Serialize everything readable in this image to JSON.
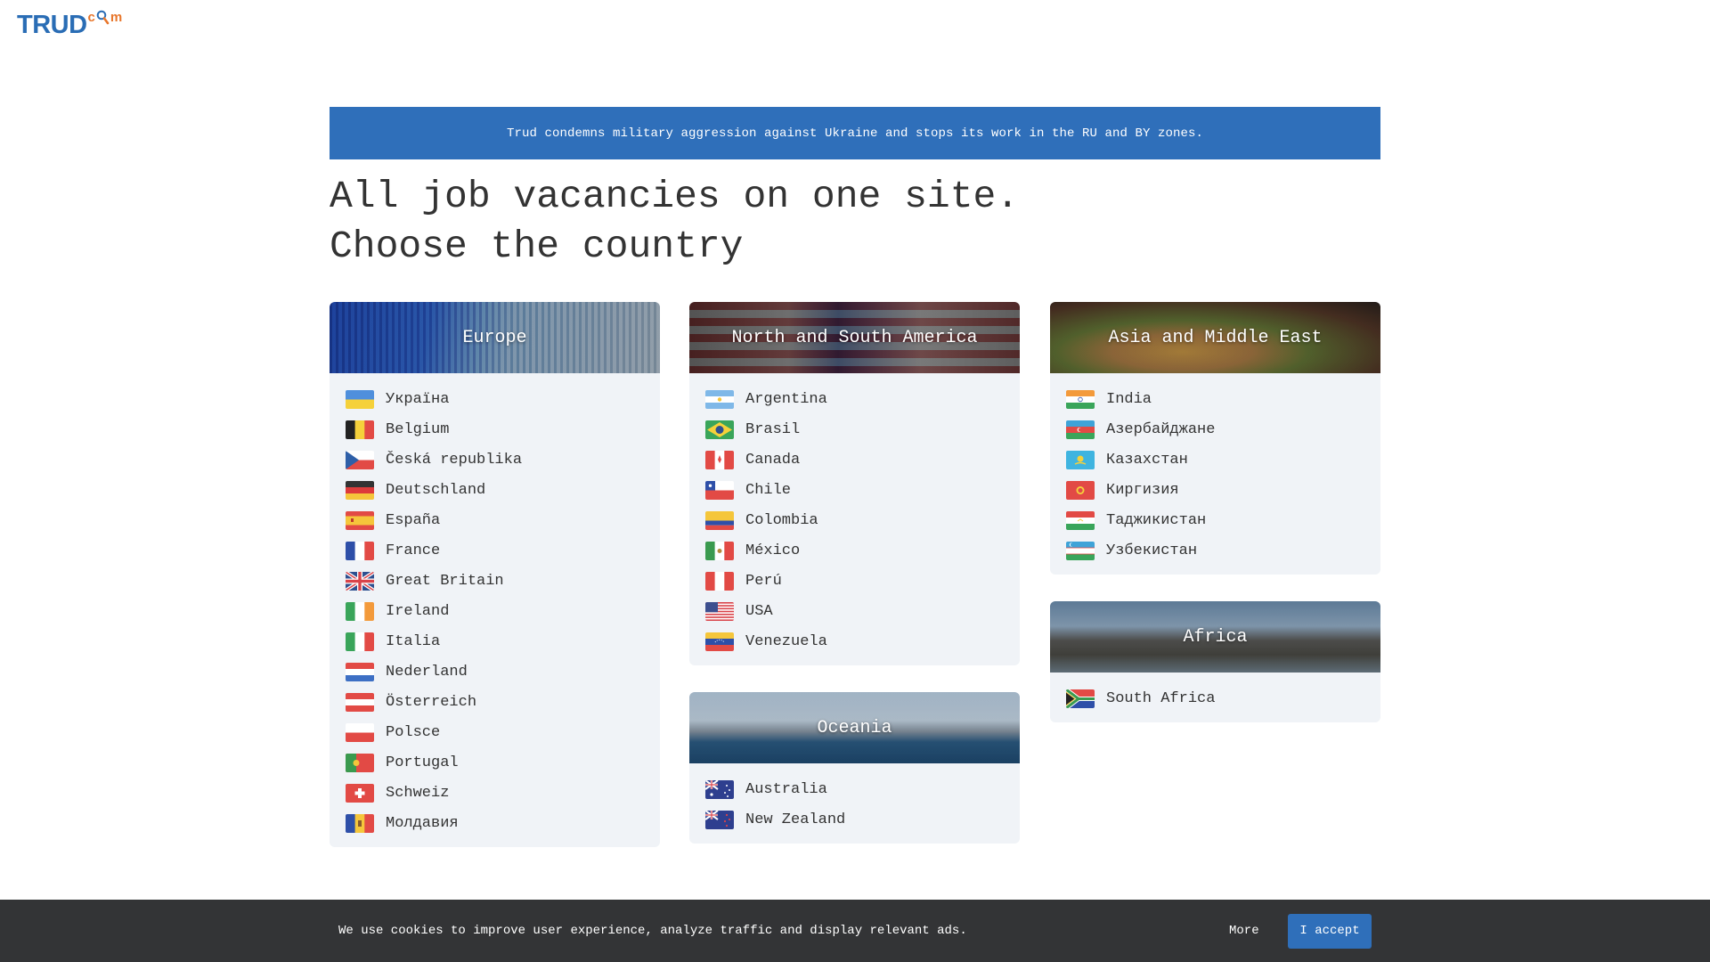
{
  "logo": {
    "main": "TRUD",
    "sup_c": "c",
    "sup_m": "m"
  },
  "notice": "Trud condemns military aggression against Ukraine and stops its work in the RU and BY zones.",
  "heading": {
    "line1": "All job vacancies on one site.",
    "line2": "Choose the country"
  },
  "regions": {
    "europe": {
      "title": "Europe",
      "countries": [
        "Україна",
        "Belgium",
        "Česká republika",
        "Deutschland",
        "España",
        "France",
        "Great Britain",
        "Ireland",
        "Italia",
        "Nederland",
        "Österreich",
        "Polsce",
        "Portugal",
        "Schweiz",
        "Молдавия"
      ]
    },
    "america": {
      "title": "North and South America",
      "countries": [
        "Argentina",
        "Brasil",
        "Canada",
        "Chile",
        "Colombia",
        "México",
        "Perú",
        "USA",
        "Venezuela"
      ]
    },
    "oceania": {
      "title": "Oceania",
      "countries": [
        "Australia",
        "New Zealand"
      ]
    },
    "asia": {
      "title": "Asia and Middle East",
      "countries": [
        "India",
        "Азербайджане",
        "Казахстан",
        "Киргизия",
        "Таджикистан",
        "Узбекистан"
      ]
    },
    "africa": {
      "title": "Africa",
      "countries": [
        "South Africa"
      ]
    }
  },
  "cookie": {
    "text": "We use cookies to improve user experience, analyze traffic and display relevant ads.",
    "more": "More",
    "accept": "I accept"
  },
  "colors": {
    "brand_blue": "#2f6fba",
    "logo_orange": "#e8762b",
    "card_bg": "#f0f3f7",
    "cookie_bg": "#333436"
  }
}
